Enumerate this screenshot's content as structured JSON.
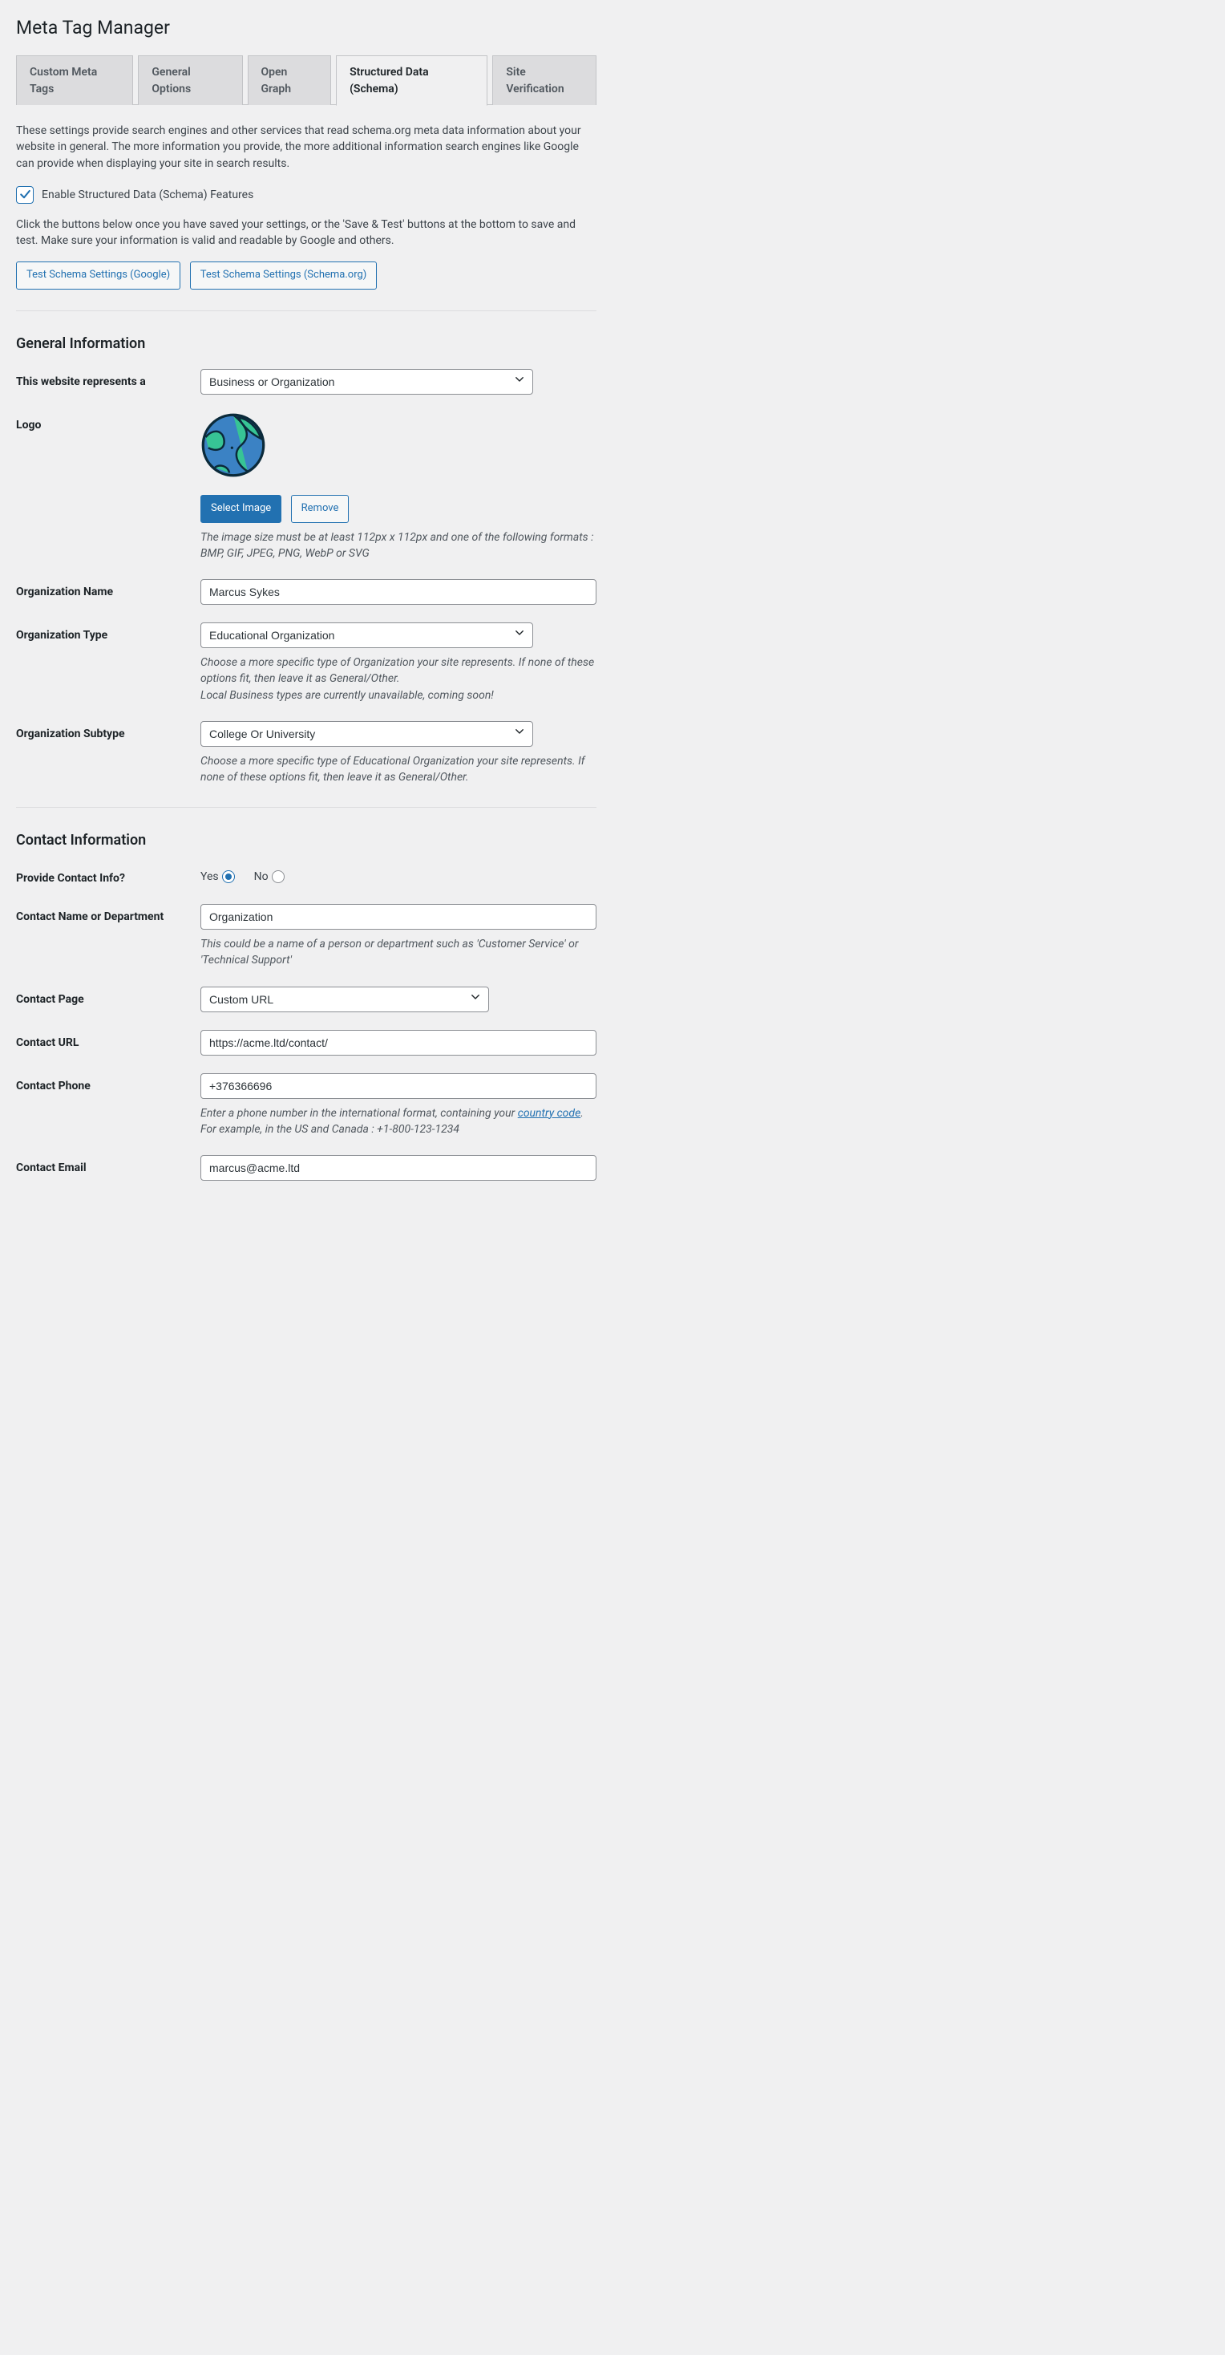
{
  "page": {
    "title": "Meta Tag Manager"
  },
  "tabs": {
    "custom": "Custom Meta Tags",
    "general": "General Options",
    "og": "Open Graph",
    "schema": "Structured Data (Schema)",
    "verify": "Site Verification"
  },
  "intro": "These settings provide search engines and other services that read schema.org meta data information about your website in general. The more information you provide, the more additional information search engines like Google can provide when displaying your site in search results.",
  "enable_label": "Enable Structured Data (Schema) Features",
  "test_intro": "Click the buttons below once you have saved your settings, or the 'Save & Test' buttons at the bottom to save and test. Make sure your information is valid and readable by Google and others.",
  "buttons": {
    "test_google": "Test Schema Settings (Google)",
    "test_schema": "Test Schema Settings (Schema.org)",
    "select_image": "Select Image",
    "remove": "Remove"
  },
  "sections": {
    "general": "General Information",
    "contact": "Contact Information"
  },
  "labels": {
    "represents": "This website represents a",
    "logo": "Logo",
    "org_name": "Organization Name",
    "org_type": "Organization Type",
    "org_subtype": "Organization Subtype",
    "provide_contact": "Provide Contact Info?",
    "contact_name": "Contact Name or Department",
    "contact_page": "Contact Page",
    "contact_url": "Contact URL",
    "contact_phone": "Contact Phone",
    "contact_email": "Contact Email",
    "yes": "Yes",
    "no": "No"
  },
  "values": {
    "represents": "Business or Organization",
    "org_name": "Marcus Sykes",
    "org_type": "Educational Organization",
    "org_subtype": "College Or University",
    "contact_name": "Organization",
    "contact_page": "Custom URL",
    "contact_url": "https://acme.ltd/contact/",
    "contact_phone": "+376366696",
    "contact_email": "marcus@acme.ltd"
  },
  "desc": {
    "logo": "The image size must be at least 112px x 112px and one of the following formats : BMP, GIF, JPEG, PNG, WebP or SVG",
    "org_type1": "Choose a more specific type of Organization your site represents. If none of these options fit, then leave it as General/Other.",
    "org_type2": "Local Business types are currently unavailable, coming soon!",
    "org_subtype": "Choose a more specific type of Educational Organization your site represents. If none of these options fit, then leave it as General/Other.",
    "contact_name": "This could be a name of a person or department such as 'Customer Service' or 'Technical Support'",
    "phone_pre": "Enter a phone number in the international format, containing your ",
    "phone_link": "country code",
    "phone_post": ". For example, in the US and Canada : +1-800-123-1234"
  }
}
